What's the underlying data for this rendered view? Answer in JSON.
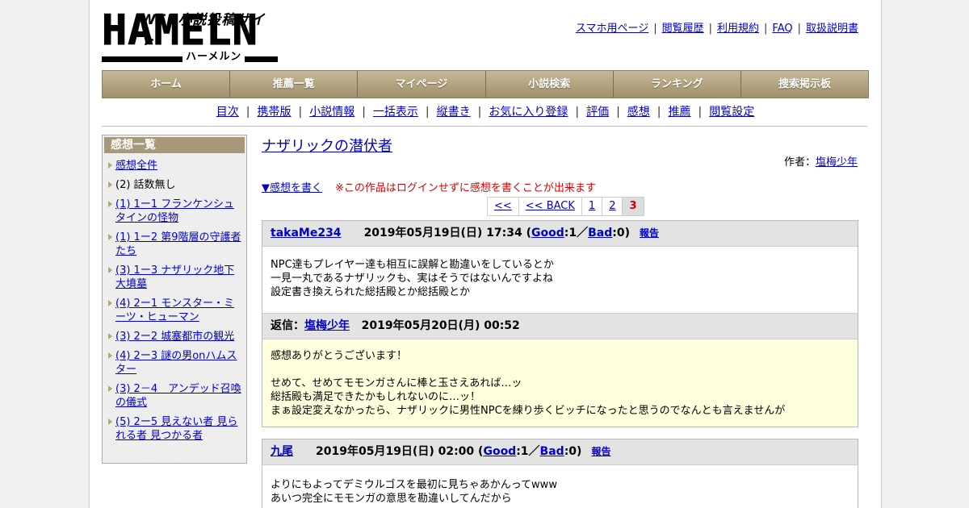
{
  "logo": {
    "tagline": "WEB小説投稿サイト",
    "wordmark": "HAMELN",
    "kana": "ハーメルン"
  },
  "top_links": [
    "スマホ用ページ",
    "閲覧履歴",
    "利用規約",
    "FAQ",
    "取扱説明書"
  ],
  "main_nav": [
    "ホーム",
    "推薦一覧",
    "マイページ",
    "小説検索",
    "ランキング",
    "捜索掲示板"
  ],
  "sub_nav": [
    "目次",
    "携帯版",
    "小説情報",
    "一括表示",
    "縦書き",
    "お気に入り登録",
    "評価",
    "感想",
    "推薦",
    "閲覧設定"
  ],
  "sidebar": {
    "heading": "感想一覧",
    "items": [
      {
        "label": "感想全件",
        "link": true
      },
      {
        "label": "(2) 話数無し",
        "link": false
      },
      {
        "label": "(1) 1ー1 フランケンシュタインの怪物",
        "link": true
      },
      {
        "label": "(1) 1ー2 第9階層の守護者たち",
        "link": true
      },
      {
        "label": "(3) 1ー3 ナザリック地下大墳墓",
        "link": true
      },
      {
        "label": "(4) 2ー1 モンスター・ミーツ・ヒューマン",
        "link": true
      },
      {
        "label": "(3) 2ー2 城塞都市の観光",
        "link": true
      },
      {
        "label": "(4) 2ー3 謎の男onハムスター",
        "link": true
      },
      {
        "label": "(3) 2－4　アンデッド召喚の儀式",
        "link": true
      },
      {
        "label": "(5) 2ー5 見えない者 見られる者 見つかる者",
        "link": true
      }
    ]
  },
  "main": {
    "novel_title": "ナザリックの潜伏者",
    "author_label": "作者：",
    "author_name": "塩梅少年",
    "write_link": "▼感想を書く",
    "login_note": "※この作品はログインせずに感想を書くことが出来ます",
    "pager": [
      "<<",
      "<< BACK",
      "1",
      "2",
      "3"
    ],
    "pager_current": "3"
  },
  "comments": [
    {
      "user": "takaMe234",
      "date": "2019年05月19日(日) 17:34",
      "good_label": "Good",
      "good_count": ":1",
      "bad_label": "Bad",
      "bad_count": ":0",
      "report": "報告",
      "lines": [
        "NPC達もプレイヤー達も相互に誤解と勘違いをしているとか",
        "一見一丸であるナザリックも、実はそうではないんですよね",
        "設定書き換えられた総括殿とか総括殿とか"
      ],
      "reply": {
        "label": "返信：",
        "author": "塩梅少年",
        "date": "2019年05月20日(月) 00:52",
        "lines": [
          "感想ありがとうございます！",
          "",
          "せめて、せめてモモンガさんに棒と玉さえあれば…ッ",
          "総括殿も満足できたかもしれないのに…ッ！",
          "まぁ設定変えなかったら、ナザリックに男性NPCを練り歩くビッチになったと思うのでなんとも言えませんが"
        ]
      }
    },
    {
      "user": "九尾",
      "date": "2019年05月19日(日) 02:00",
      "good_label": "Good",
      "good_count": ":1",
      "bad_label": "Bad",
      "bad_count": ":0",
      "report": "報告",
      "lines": [
        "よりにもよってデミウルゴスを最初に見ちゃあかんってwww",
        "あいつ完全にモモンガの意思を勘違いしてんだから"
      ]
    }
  ]
}
